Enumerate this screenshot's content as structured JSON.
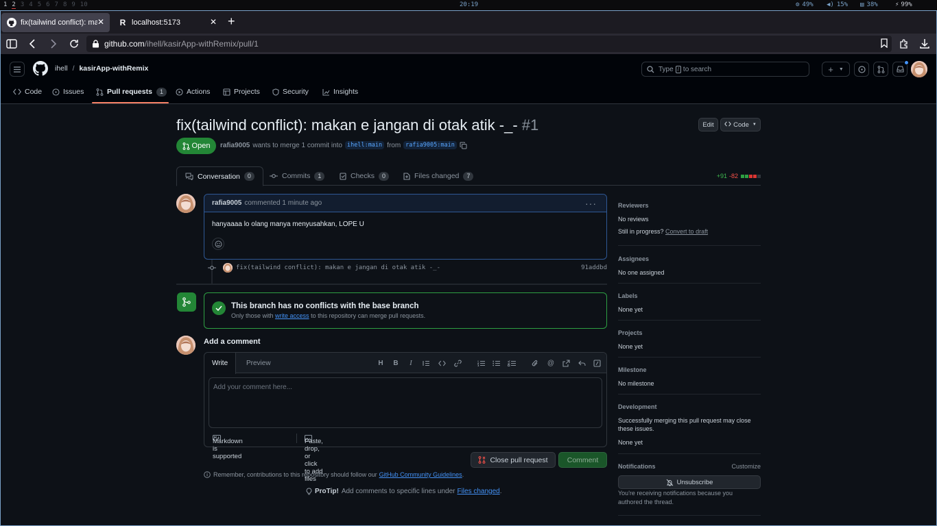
{
  "system_bar": {
    "workspaces": [
      "1",
      "2",
      "3",
      "4",
      "5",
      "6",
      "7",
      "8",
      "9",
      "10"
    ],
    "clock": "20:19",
    "cpu": "49%",
    "volume": "15%",
    "memory": "38%",
    "battery": "99%"
  },
  "browser": {
    "tabs": [
      {
        "title": "fix(tailwind conflict): ma",
        "favicon": "github-icon",
        "active": true
      },
      {
        "title": "localhost:5173",
        "favicon": "remix-icon",
        "active": false
      }
    ],
    "url_host": "github.com",
    "url_path": "/ihell/kasirApp-withRemix/pull/1"
  },
  "github": {
    "owner": "ihell",
    "separator": "/",
    "repo": "kasirApp-withRemix",
    "search_placeholder_pre": "Type",
    "search_key": "/",
    "search_placeholder_post": "to search",
    "nav": [
      {
        "label": "Code",
        "icon": "code-icon"
      },
      {
        "label": "Issues",
        "icon": "issue-icon"
      },
      {
        "label": "Pull requests",
        "icon": "pull-request-icon",
        "count": "1",
        "selected": true
      },
      {
        "label": "Actions",
        "icon": "play-icon"
      },
      {
        "label": "Projects",
        "icon": "table-icon"
      },
      {
        "label": "Security",
        "icon": "shield-icon"
      },
      {
        "label": "Insights",
        "icon": "graph-icon"
      }
    ]
  },
  "pr": {
    "title": "fix(tailwind conflict): makan e jangan di otak atik -_-",
    "number": "#1",
    "edit_label": "Edit",
    "code_label": "Code",
    "state": "Open",
    "author": "rafia9005",
    "merge_text": "wants to merge 1 commit into",
    "base_branch": "ihell:main",
    "from_text": "from",
    "head_branch": "rafia9005:main",
    "tabs": [
      {
        "label": "Conversation",
        "count": "0"
      },
      {
        "label": "Commits",
        "count": "1"
      },
      {
        "label": "Checks",
        "count": "0"
      },
      {
        "label": "Files changed",
        "count": "7"
      }
    ],
    "additions": "+91",
    "deletions": "-82"
  },
  "comment": {
    "author": "rafia9005",
    "meta": "commented 1 minute ago",
    "body": "hanyaaaa lo olang manya menyusahkan, LOPE U"
  },
  "commit": {
    "message": "fix(tailwind conflict): makan e jangan di otak atik -_-",
    "sha": "91addbd"
  },
  "merge": {
    "title": "This branch has no conflicts with the base branch",
    "sub_pre": "Only those with",
    "sub_link": "write access",
    "sub_post": "to this repository can merge pull requests."
  },
  "composer": {
    "heading": "Add a comment",
    "write_tab": "Write",
    "preview_tab": "Preview",
    "placeholder": "Add your comment here...",
    "markdown_note": "Markdown is supported",
    "attach_note": "Paste, drop, or click to add files",
    "close_label": "Close pull request",
    "comment_label": "Comment",
    "remember_pre": "Remember, contributions to this repository should follow our",
    "remember_link": "GitHub Community Guidelines",
    "remember_post": ".",
    "protip_label": "ProTip!",
    "protip_pre": "Add comments to specific lines under",
    "protip_link": "Files changed",
    "protip_post": "."
  },
  "sidebar": {
    "reviewers_h": "Reviewers",
    "reviewers_v": "No reviews",
    "still_pre": "Still in progress?",
    "still_link": "Convert to draft",
    "assignees_h": "Assignees",
    "assignees_v": "No one assigned",
    "labels_h": "Labels",
    "labels_v": "None yet",
    "projects_h": "Projects",
    "projects_v": "None yet",
    "milestone_h": "Milestone",
    "milestone_v": "No milestone",
    "development_h": "Development",
    "development_text": "Successfully merging this pull request may close these issues.",
    "development_v": "None yet",
    "notifications_h": "Notifications",
    "customize": "Customize",
    "unsubscribe": "Unsubscribe",
    "notif_note": "You're receiving notifications because you authored the thread."
  },
  "colors": {
    "accent_green": "#238636",
    "link_blue": "#4493f8",
    "tab_underline": "#f78166",
    "comment_border": "#2f5895"
  }
}
